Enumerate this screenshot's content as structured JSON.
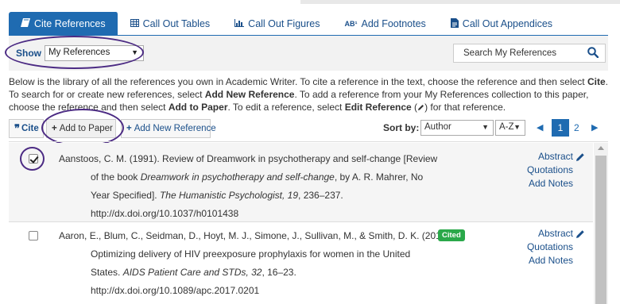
{
  "tabs": [
    {
      "label": "Cite References",
      "icon": "book-icon",
      "active": true
    },
    {
      "label": "Call Out Tables",
      "icon": "table-icon",
      "active": false
    },
    {
      "label": "Call Out Figures",
      "icon": "bar-chart-icon",
      "active": false
    },
    {
      "label": "Add Footnotes",
      "icon": "footnote-icon",
      "icon_text": "AB¹",
      "active": false
    },
    {
      "label": "Call Out Appendices",
      "icon": "document-icon",
      "active": false
    }
  ],
  "filter": {
    "show_label": "Show",
    "show_value": "My References",
    "search_placeholder": "Search My References"
  },
  "description": {
    "p1": "Below is the library of all the references you own in Academic Writer. To cite a reference in the text, choose the reference and then select ",
    "b1": "Cite",
    "p2": ". To search for or create new references, select ",
    "b2": "Add New Reference",
    "p3": ". To add a reference from your My References collection to this paper, choose the reference and then select ",
    "b3": "Add to Paper",
    "p4": ". To edit a reference, select ",
    "b4": "Edit Reference",
    "p5": " for that reference."
  },
  "toolbar": {
    "cite_label": "Cite",
    "add_to_paper_label": "Add to Paper",
    "add_new_label": "Add New Reference",
    "sort_label": "Sort by:",
    "sort_value": "Author",
    "order_value": "A-Z",
    "page_current": "1",
    "page_next": "2"
  },
  "references": [
    {
      "checked": true,
      "lines": [
        "Aanstoos, C. M. (1991). Review of Dreamwork in psychotherapy and self-change [Review",
        "of the book ",
        "Dreamwork in psychotherapy and self-change",
        ", by A. R. Mahrer, No",
        "Year Specified]. ",
        "The Humanistic Psychologist, 19",
        ", 236–237.",
        "http://dx.doi.org/10.1037/h0101438"
      ],
      "links": [
        "Abstract",
        "Quotations",
        "Add Notes"
      ],
      "cited": ""
    },
    {
      "checked": false,
      "lines": [
        "Aaron, E., Blum, C., Seidman, D., Hoyt, M. J., Simone, J., Sullivan, M., & Smith, D. K. (2018).",
        "Optimizing delivery of HIV preexposure prophylaxis for women in the United",
        "States. ",
        "AIDS Patient Care and STDs, 32",
        ", 16–23.",
        "http://dx.doi.org/10.1089/apc.2017.0201"
      ],
      "links": [
        "Abstract",
        "Quotations",
        "Add Notes"
      ],
      "cited": "Cited"
    }
  ],
  "colors": {
    "accent": "#1f6bb1",
    "highlight_ellipse": "#4b2a83",
    "cited_badge": "#2aa84a"
  }
}
